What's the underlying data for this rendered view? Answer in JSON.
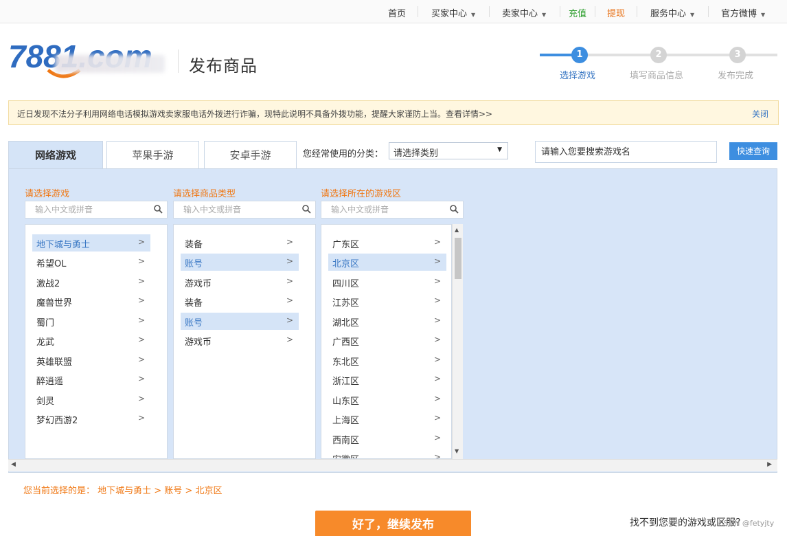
{
  "topnav": {
    "home": "首页",
    "buyer_center": "买家中心",
    "seller_center": "卖家中心",
    "recharge": "充值",
    "withdraw": "提现",
    "service_center": "服务中心",
    "official_weibo": "官方微博",
    "caret": "▼"
  },
  "header": {
    "logo_text": "7881.com",
    "page_title": "发布商品"
  },
  "steps": [
    {
      "number": "1",
      "label": "选择游戏",
      "active": true
    },
    {
      "number": "2",
      "label": "填写商品信息",
      "active": false
    },
    {
      "number": "3",
      "label": "发布完成",
      "active": false
    }
  ],
  "notice": {
    "text": "近日发现不法分子利用网络电话模拟游戏卖家服电话外拨进行诈骗，现特此说明不具备外拨功能，提醒大家谨防上当。查看详情>>",
    "close": "关闭"
  },
  "tabs": [
    {
      "label": "网络游戏",
      "active": true
    },
    {
      "label": "苹果手游",
      "active": false
    },
    {
      "label": "安卓手游",
      "active": false
    }
  ],
  "category": {
    "label": "您经常使用的分类：",
    "selected": "请选择类别",
    "arrow": "▼"
  },
  "search": {
    "placeholder": "请输入您要搜索游戏名",
    "button": "快速查询"
  },
  "columns": [
    {
      "title": "请选择游戏",
      "filter_placeholder": "输入中文或拼音",
      "items": [
        {
          "label": "地下城与勇士",
          "selected": true
        },
        {
          "label": "希望OL",
          "selected": false
        },
        {
          "label": "激战2",
          "selected": false
        },
        {
          "label": "魔兽世界",
          "selected": false
        },
        {
          "label": "蜀门",
          "selected": false
        },
        {
          "label": "龙武",
          "selected": false
        },
        {
          "label": "英雄联盟",
          "selected": false
        },
        {
          "label": "醉逍遥",
          "selected": false
        },
        {
          "label": "剑灵",
          "selected": false
        },
        {
          "label": "梦幻西游2",
          "selected": false
        }
      ]
    },
    {
      "title": "请选择商品类型",
      "filter_placeholder": "输入中文或拼音",
      "items": [
        {
          "label": "装备",
          "selected": false
        },
        {
          "label": "账号",
          "selected": true
        },
        {
          "label": "游戏币",
          "selected": false
        },
        {
          "label": "装备",
          "selected": false
        },
        {
          "label": "账号",
          "selected": true
        },
        {
          "label": "游戏币",
          "selected": false
        }
      ]
    },
    {
      "title": "请选择所在的游戏区",
      "filter_placeholder": "输入中文或拼音",
      "items": [
        {
          "label": "广东区",
          "selected": false
        },
        {
          "label": "北京区",
          "selected": true
        },
        {
          "label": "四川区",
          "selected": false
        },
        {
          "label": "江苏区",
          "selected": false
        },
        {
          "label": "湖北区",
          "selected": false
        },
        {
          "label": "广西区",
          "selected": false
        },
        {
          "label": "东北区",
          "selected": false
        },
        {
          "label": "浙江区",
          "selected": false
        },
        {
          "label": "山东区",
          "selected": false
        },
        {
          "label": "上海区",
          "selected": false
        },
        {
          "label": "西南区",
          "selected": false
        },
        {
          "label": "安徽区",
          "selected": false
        }
      ]
    }
  ],
  "chevron": ">",
  "selection": {
    "text": "您当前选择的是：  地下城与勇士 > 账号 > 北京区"
  },
  "footer": {
    "submit": "好了，继续发布",
    "help": "找不到您要的游戏或区服？",
    "watermark": "CSDN @fetyjty"
  },
  "colors": {
    "accent_blue": "#3d8ee0",
    "orange": "#f07814",
    "panel_bg": "#d7e5f8",
    "submit_bg": "#f78a2a",
    "recharge_green": "#2a9d2a",
    "withdraw_orange": "#e8731a"
  },
  "icons": {
    "search": "magnifier-icon",
    "dropdown": "caret-down-icon",
    "chevron": "chevron-right-icon"
  }
}
